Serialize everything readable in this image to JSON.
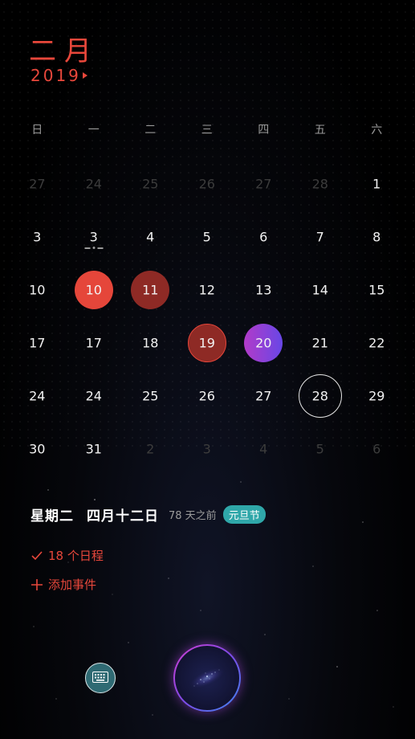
{
  "header": {
    "month": "二月",
    "year": "2019"
  },
  "weekdays": [
    "日",
    "一",
    "二",
    "三",
    "四",
    "五",
    "六"
  ],
  "calendar": {
    "weeks": [
      [
        {
          "num": "27",
          "dim": true
        },
        {
          "num": "24",
          "dim": true
        },
        {
          "num": "25",
          "dim": true
        },
        {
          "num": "26",
          "dim": true
        },
        {
          "num": "27",
          "dim": true
        },
        {
          "num": "28",
          "dim": true
        },
        {
          "num": "1"
        }
      ],
      [
        {
          "num": "3"
        },
        {
          "num": "3",
          "mark": true
        },
        {
          "num": "4"
        },
        {
          "num": "5"
        },
        {
          "num": "6"
        },
        {
          "num": "7"
        },
        {
          "num": "8"
        }
      ],
      [
        {
          "num": "10"
        },
        {
          "num": "10",
          "style": "red"
        },
        {
          "num": "11",
          "style": "darkred"
        },
        {
          "num": "12"
        },
        {
          "num": "13"
        },
        {
          "num": "14"
        },
        {
          "num": "15"
        }
      ],
      [
        {
          "num": "17"
        },
        {
          "num": "17"
        },
        {
          "num": "18"
        },
        {
          "num": "19",
          "style": "ring-red"
        },
        {
          "num": "20",
          "style": "purple"
        },
        {
          "num": "21"
        },
        {
          "num": "22"
        }
      ],
      [
        {
          "num": "24"
        },
        {
          "num": "24"
        },
        {
          "num": "25"
        },
        {
          "num": "26"
        },
        {
          "num": "27"
        },
        {
          "num": "28",
          "style": "ring-white"
        },
        {
          "num": "29"
        }
      ],
      [
        {
          "num": "30"
        },
        {
          "num": "31"
        },
        {
          "num": "2",
          "dim": true
        },
        {
          "num": "3",
          "dim": true
        },
        {
          "num": "4",
          "dim": true
        },
        {
          "num": "5",
          "dim": true
        },
        {
          "num": "6",
          "dim": true
        }
      ]
    ]
  },
  "selected_day": {
    "weekday": "星期二",
    "lunar": "四月十二日",
    "relative": "78 天之前",
    "holiday": "元旦节"
  },
  "actions": {
    "events_label": "18 个日程",
    "add_label": "添加事件"
  },
  "colors": {
    "accent": "#e8473b",
    "holiday": "#2fa7a9"
  },
  "icons": {
    "keyboard": "keyboard-icon",
    "voice": "voice-assistant-icon",
    "check": "check-icon",
    "plus": "plus-icon"
  }
}
